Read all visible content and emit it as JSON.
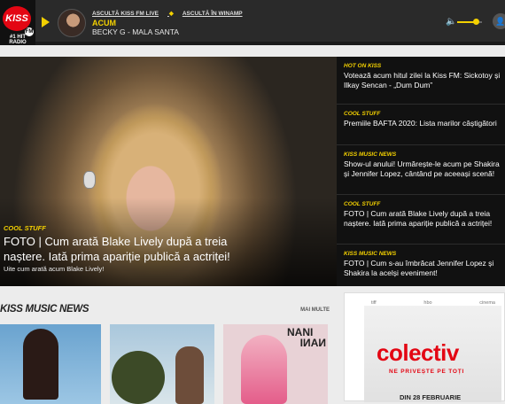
{
  "header": {
    "logo_text": "KISS",
    "logo_fm": "FM",
    "logo_slogan": "#1 HIT RADIO",
    "links": [
      "ASCULTĂ KISS FM LIVE",
      "ASCULTĂ ÎN WINAMP"
    ],
    "now_label": "ACUM",
    "now_song": "BECKY G - MALA SANTA",
    "volume_level": 0.75
  },
  "hero": {
    "category": "COOL STUFF",
    "title": "FOTO | Cum arată Blake Lively după a treia naștere. Iată prima apariție publică a actriței!",
    "subtitle": "Uite cum arată acum Blake Lively!"
  },
  "sidebar": {
    "items": [
      {
        "category": "HOT ON KISS",
        "title": "Votează acum hitul zilei la Kiss FM: Sickotoy și Ilkay Sencan - „Dum Dum”"
      },
      {
        "category": "COOL STUFF",
        "title": "Premiile BAFTA 2020: Lista marilor câștigători"
      },
      {
        "category": "KISS MUSIC NEWS",
        "title": "Show-ul anului! Urmărește-le acum pe Shakira și Jennifer Lopez, cântând pe aceeași scenă!"
      },
      {
        "category": "COOL STUFF",
        "title": "FOTO | Cum arată Blake Lively după a treia naștere. Iată prima apariție publică a actriței!"
      },
      {
        "category": "KISS MUSIC NEWS",
        "title": "FOTO | Cum s-au îmbrăcat Jennifer Lopez și Shakira la acelși eveniment!"
      }
    ]
  },
  "news": {
    "title": "KISS MUSIC NEWS",
    "more": "MAI MULTE",
    "card3_text": "NANI"
  },
  "ad": {
    "logos": [
      "tiff",
      "",
      "hbo",
      "cinema"
    ],
    "brand": "colectiv",
    "tagline": "NE PRIVEȘTE PE TOȚI",
    "date": "DIN 28 FEBRUARIE"
  }
}
